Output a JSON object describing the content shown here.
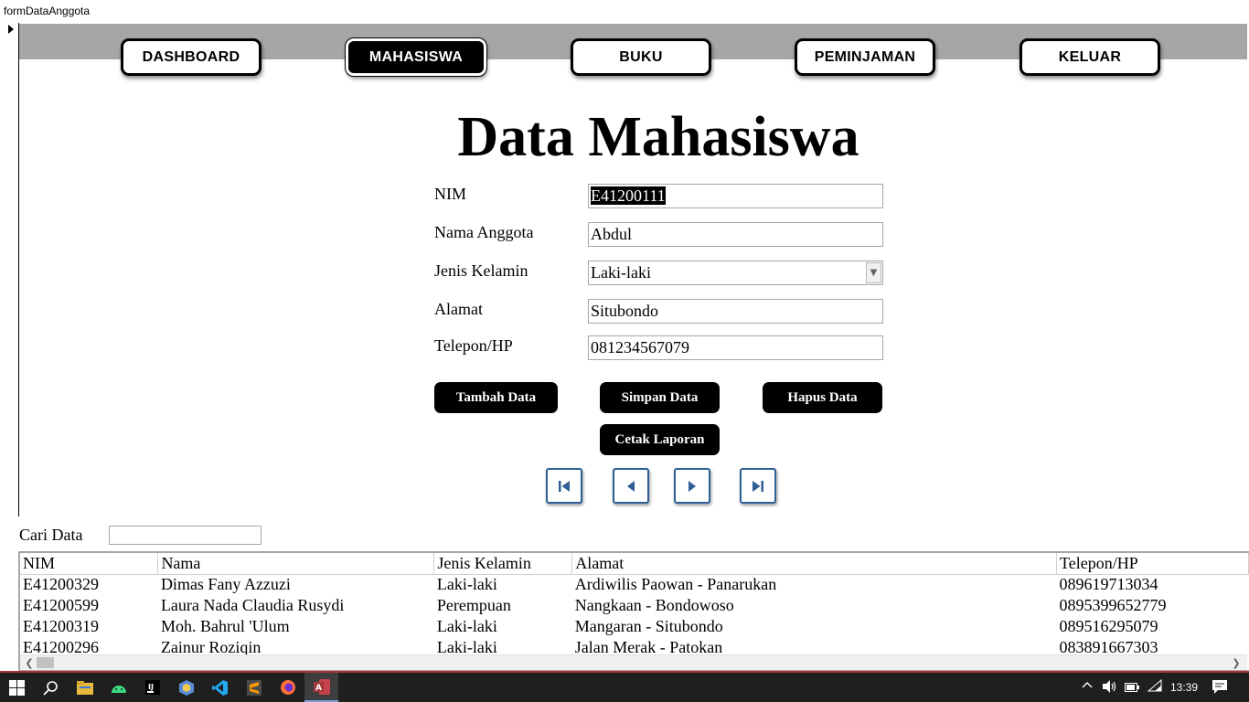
{
  "window": {
    "title": "formDataAnggota"
  },
  "nav": {
    "dashboard": "DASHBOARD",
    "mahasiswa": "MAHASISWA",
    "buku": "BUKU",
    "peminjaman": "PEMINJAMAN",
    "keluar": "KELUAR",
    "active": "MAHASISWA"
  },
  "form": {
    "title": "Data Mahasiswa",
    "nim_label": "NIM",
    "nim_value": "E41200111",
    "nama_label": "Nama Anggota",
    "nama_value": "Abdul",
    "jk_label": "Jenis Kelamin",
    "jk_value": "Laki-laki",
    "alamat_label": "Alamat",
    "alamat_value": "Situbondo",
    "telp_label": "Telepon/HP",
    "telp_value": "081234567079"
  },
  "actions": {
    "tambah": "Tambah Data",
    "simpan": "Simpan Data",
    "hapus": "Hapus Data",
    "cetak": "Cetak Laporan"
  },
  "search": {
    "label": "Cari Data",
    "value": ""
  },
  "grid": {
    "columns": [
      "NIM",
      "Nama",
      "Jenis Kelamin",
      "Alamat",
      "Telepon/HP"
    ],
    "rows": [
      [
        "E41200329",
        "Dimas Fany Azzuzi",
        "Laki-laki",
        "Ardiwilis Paowan - Panarukan",
        "089619713034"
      ],
      [
        "E41200599",
        "Laura Nada Claudia Rusydi",
        "Perempuan",
        "Nangkaan - Bondowoso",
        "0895399652779"
      ],
      [
        "E41200319",
        "Moh. Bahrul 'Ulum",
        "Laki-laki",
        "Mangaran - Situbondo",
        "089516295079"
      ],
      [
        "E41200296",
        "Zainur Roziqin",
        "Laki-laki",
        "Jalan Merak - Patokan",
        "083891667303"
      ]
    ]
  },
  "taskbar": {
    "time": "13:39",
    "apps": [
      "windows-start-icon",
      "search-icon",
      "file-explorer-icon",
      "android-studio-icon",
      "intellij-icon",
      "app-icon",
      "vscode-icon",
      "sublime-icon",
      "firefox-icon",
      "access-icon"
    ]
  },
  "colors": {
    "nav_band": "#a6a6a6",
    "record_button_border": "#2f5f95",
    "access_accent": "#a4373a"
  }
}
